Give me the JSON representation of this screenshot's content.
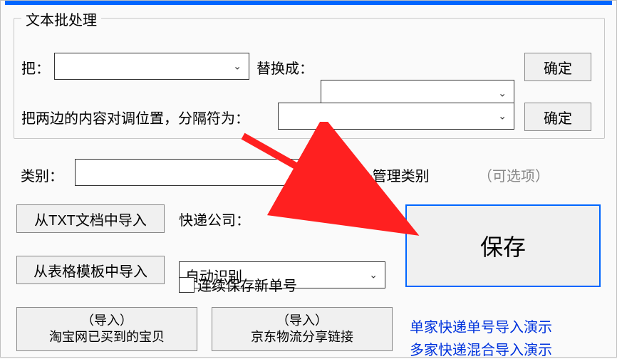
{
  "fieldset": {
    "legend": "文本批处理",
    "row1": {
      "label_from": "把：",
      "label_to": "替换成：",
      "confirm": "确定"
    },
    "row2": {
      "label_swap": "把两边的内容对调位置，分隔符为：",
      "confirm": "确定"
    }
  },
  "category": {
    "label": "类别：",
    "manage_label": "+管理类别",
    "optional_label": "（可选项）"
  },
  "imports": {
    "from_txt": "从TXT文档中导入",
    "from_template": "从表格模板中导入",
    "taobao_top": "（导入）",
    "taobao_bottom": "淘宝网已买到的宝贝",
    "jd_top": "（导入）",
    "jd_bottom": "京东物流分享链接"
  },
  "courier": {
    "label": "快递公司：",
    "selected": "自动识别",
    "checkbox_label": "连续保存新单号"
  },
  "save_label": "保存",
  "demo_links": {
    "single": "单家快递单号导入演示",
    "multi": "多家快递混合导入演示"
  }
}
